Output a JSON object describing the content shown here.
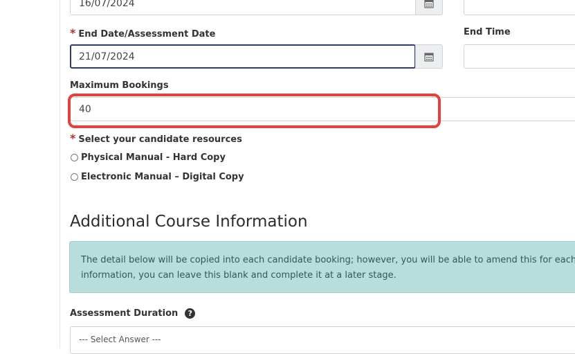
{
  "form": {
    "start_date_value": "16/07/2024",
    "end_date": {
      "required_mark": "*",
      "label": "End Date/Assessment Date",
      "value": "21/07/2024"
    },
    "end_time": {
      "label": "End Time",
      "value": ""
    },
    "max_bookings": {
      "label": "Maximum Bookings",
      "value": "40"
    },
    "resources": {
      "required_mark": "*",
      "label": "Select your candidate resources",
      "options": [
        {
          "label": "Physical Manual - Hard Copy",
          "selected": false
        },
        {
          "label": "Electronic Manual – Digital Copy",
          "selected": false
        }
      ]
    }
  },
  "additional": {
    "title": "Additional Course Information",
    "info_line1": "The detail below will be copied into each candidate booking; however, you will be able to amend this for each candidate",
    "info_line2": "information, you can leave this blank and complete it at a later stage.",
    "assessment_duration": {
      "label": "Assessment Duration",
      "help_icon": "?",
      "placeholder": "--- Select Answer ---"
    }
  },
  "icons": {
    "calendar": "calendar-icon",
    "help": "question-circle-icon"
  },
  "colors": {
    "highlight": "#e3413a",
    "required": "#b0322c",
    "info_bg": "#b9dcdc",
    "focus_border": "#2f3a66"
  }
}
